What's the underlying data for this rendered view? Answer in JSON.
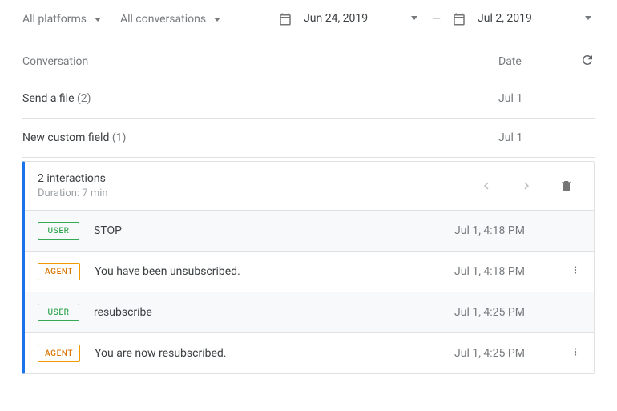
{
  "filters": {
    "platform": "All platforms",
    "conversation": "All conversations",
    "date_start": "Jun 24, 2019",
    "date_end": "Jul 2, 2019"
  },
  "table": {
    "header_conversation": "Conversation",
    "header_date": "Date",
    "rows": [
      {
        "title": "Send a file",
        "count": "(2)",
        "date": "Jul 1"
      },
      {
        "title": "New custom field",
        "count": "(1)",
        "date": "Jul 1"
      }
    ]
  },
  "panel": {
    "interactions": "2 interactions",
    "duration": "Duration: 7 min",
    "messages": [
      {
        "role": "USER",
        "role_class": "user",
        "text": "STOP",
        "time": "Jul 1, 4:18 PM",
        "kebab": false,
        "alt": true
      },
      {
        "role": "AGENT",
        "role_class": "agent",
        "text": "You have been unsubscribed.",
        "time": "Jul 1, 4:18 PM",
        "kebab": true,
        "alt": false
      },
      {
        "role": "USER",
        "role_class": "user",
        "text": "resubscribe",
        "time": "Jul 1, 4:25 PM",
        "kebab": false,
        "alt": true
      },
      {
        "role": "AGENT",
        "role_class": "agent",
        "text": "You are now resubscribed.",
        "time": "Jul 1, 4:25 PM",
        "kebab": true,
        "alt": false
      }
    ]
  }
}
